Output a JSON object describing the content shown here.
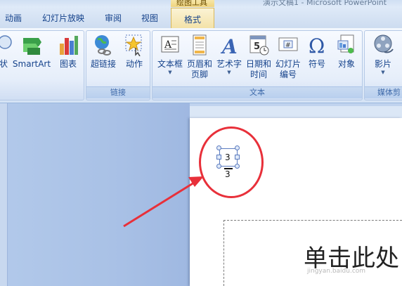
{
  "window": {
    "title": "演示文稿1 - Microsoft PowerPoint",
    "context_tab_group": "绘图工具"
  },
  "tabs": {
    "animation": "动画",
    "slideshow": "幻灯片放映",
    "review": "审阅",
    "view": "视图",
    "format": "格式"
  },
  "ribbon": {
    "illustrations": {
      "shapes_partial": "状",
      "smartart": "SmartArt",
      "chart": "图表"
    },
    "links": {
      "group_label": "链接",
      "hyperlink": "超链接",
      "action": "动作"
    },
    "text": {
      "group_label": "文本",
      "textbox": "文本框",
      "header_footer_1": "页眉和",
      "header_footer_2": "页脚",
      "wordart": "艺术字",
      "datetime_1": "日期和",
      "datetime_2": "时间",
      "slide_number_1": "幻灯片",
      "slide_number_2": "编号",
      "symbol": "符号",
      "object": "对象"
    },
    "media": {
      "group_label": "媒体剪",
      "movie": "影片"
    }
  },
  "slide": {
    "fraction_numerator": "3",
    "fraction_denominator": "3",
    "placeholder_text": "单击此处",
    "watermark": "jingyan.baidu.com"
  },
  "colors": {
    "annotation": "#e8303a",
    "ribbon_text": "#15428b"
  }
}
